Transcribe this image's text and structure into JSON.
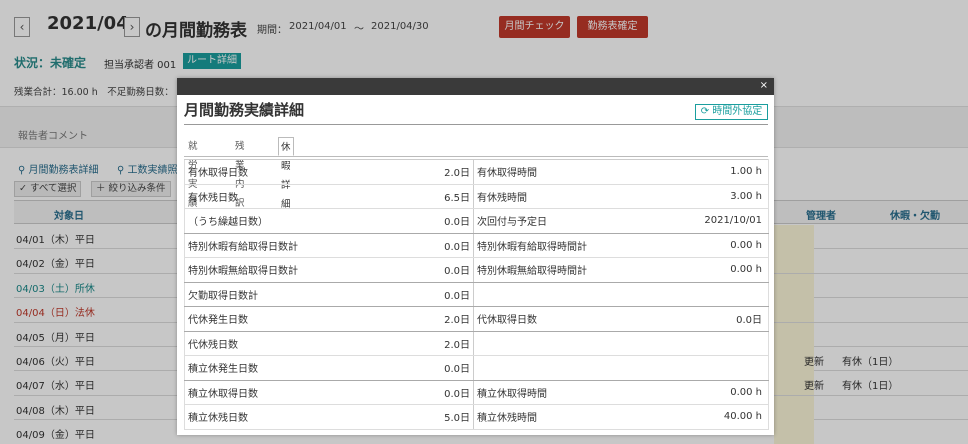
{
  "header": {
    "prev": "‹",
    "month": "2021/04",
    "next": "›",
    "title": "の月間勤務表",
    "period_label": "期間：",
    "period_from": "2021/04/01",
    "period_sep": "～",
    "period_to": "2021/04/30",
    "btn_check": "月間チェック",
    "btn_confirm": "勤務表確定"
  },
  "status": {
    "text": "状況：未確定",
    "approver": "担当承認者 001",
    "route_btn": "ルート詳細"
  },
  "summary": "残業合計：16.00 h　不足勤務日数：",
  "comment_label": "報告者コメント",
  "links": {
    "monthly_detail": "月間勤務表詳細",
    "workload": "工数実績照"
  },
  "filters": {
    "select_all": "✓ すべて選択",
    "narrow": "＋ 絞り込み条件"
  },
  "grid": {
    "col_date": "対象日",
    "col_manager": "管理者",
    "col_leave": "休暇・欠勤",
    "rows": [
      {
        "date": "04/01（木）平日",
        "manager": "",
        "leave": "",
        "color": "#333333"
      },
      {
        "date": "04/02（金）平日",
        "manager": "",
        "leave": "",
        "color": "#333333"
      },
      {
        "date": "04/03（土）所休",
        "manager": "",
        "leave": "",
        "color": "#1a8a8a"
      },
      {
        "date": "04/04（日）法休",
        "manager": "",
        "leave": "",
        "color": "#c0392b"
      },
      {
        "date": "04/05（月）平日",
        "manager": "",
        "leave": "",
        "color": "#333333"
      },
      {
        "date": "04/06（火）平日",
        "manager": "更新",
        "leave": "有休（1日）",
        "color": "#333333"
      },
      {
        "date": "04/07（水）平日",
        "manager": "更新",
        "leave": "有休（1日）",
        "color": "#333333"
      },
      {
        "date": "04/08（木）平日",
        "manager": "",
        "leave": "",
        "color": "#333333"
      },
      {
        "date": "04/09（金）平日",
        "manager": "",
        "leave": "",
        "color": "#333333"
      }
    ]
  },
  "modal": {
    "close": "×",
    "title": "月間勤務実績詳細",
    "ot_button": "時間外協定",
    "tabs": [
      {
        "label": "就労実績",
        "active": false
      },
      {
        "label": "残業内訳",
        "active": false
      },
      {
        "label": "休暇詳細",
        "active": true
      }
    ],
    "rows": [
      {
        "l1": "有休取得日数",
        "v1": "2.0日",
        "l2": "有休取得時間",
        "v2": "1.00 h",
        "group_end": false
      },
      {
        "l1": "有休残日数",
        "v1": "6.5日",
        "l2": "有休残時間",
        "v2": "3.00 h",
        "group_end": false
      },
      {
        "l1": "（うち繰越日数）",
        "v1": "0.0日",
        "l2": "次回付与予定日",
        "v2": "2021/10/01",
        "group_end": true
      },
      {
        "l1": "特別休暇有給取得日数計",
        "v1": "0.0日",
        "l2": "特別休暇有給取得時間計",
        "v2": "0.00 h",
        "group_end": false
      },
      {
        "l1": "特別休暇無給取得日数計",
        "v1": "0.0日",
        "l2": "特別休暇無給取得時間計",
        "v2": "0.00 h",
        "group_end": true
      },
      {
        "l1": "欠勤取得日数計",
        "v1": "0.0日",
        "l2": "",
        "v2": "",
        "group_end": true
      },
      {
        "l1": "代休発生日数",
        "v1": "2.0日",
        "l2": "代休取得日数",
        "v2": "0.0日",
        "group_end": true
      },
      {
        "l1": "代休残日数",
        "v1": "2.0日",
        "l2": "",
        "v2": "",
        "group_end": false
      },
      {
        "l1": "積立休発生日数",
        "v1": "0.0日",
        "l2": "",
        "v2": "",
        "group_end": true
      },
      {
        "l1": "積立休取得日数",
        "v1": "0.0日",
        "l2": "積立休取得時間",
        "v2": "0.00 h",
        "group_end": false
      },
      {
        "l1": "積立休残日数",
        "v1": "5.0日",
        "l2": "積立休残時間",
        "v2": "40.00 h",
        "group_end": false
      }
    ]
  }
}
